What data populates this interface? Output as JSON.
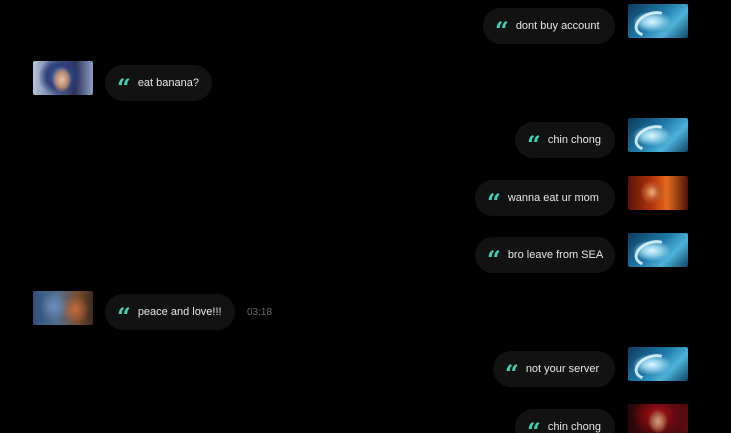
{
  "messages": [
    {
      "text": "dont buy account",
      "avatar": "player-avatar-blue-dragon"
    },
    {
      "text": "eat banana?",
      "avatar": "player-avatar-armored-hero"
    },
    {
      "text": "chin chong",
      "avatar": "player-avatar-blue-dragon"
    },
    {
      "text": "wanna eat ur mom",
      "avatar": "player-avatar-fiery-hero"
    },
    {
      "text": "bro leave from SEA",
      "avatar": "player-avatar-blue-dragon"
    },
    {
      "text": "peace and love!!!",
      "avatar": "player-avatar-duo-heroes",
      "time": "03:18"
    },
    {
      "text": "not your server",
      "avatar": "player-avatar-blue-dragon"
    },
    {
      "text": "chin chong",
      "avatar": "player-avatar-red-hooded"
    }
  ],
  "quote_glyph": "“",
  "accent_color": "#3fd1b6",
  "bubble_color": "#121212"
}
